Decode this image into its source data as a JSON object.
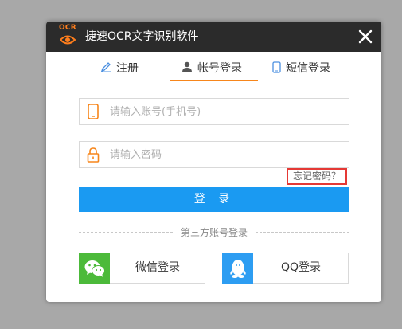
{
  "window": {
    "logo_text": "OCR",
    "title": "捷速OCR文字识别软件"
  },
  "tabs": [
    {
      "label": "注册",
      "icon": "pencil-icon",
      "active": false
    },
    {
      "label": "帐号登录",
      "icon": "user-icon",
      "active": true
    },
    {
      "label": "短信登录",
      "icon": "phone-icon",
      "active": false
    }
  ],
  "form": {
    "account_placeholder": "请输入账号(手机号)",
    "password_placeholder": "请输入密码",
    "forgot_label": "忘记密码？",
    "login_label": "登 录"
  },
  "third_party": {
    "divider_label": "第三方账号登录",
    "wechat_label": "微信登录",
    "qq_label": "QQ登录"
  },
  "colors": {
    "accent": "#f7861b",
    "primary": "#1a9af2",
    "wechat": "#4cba3a",
    "qq": "#2d9df2",
    "titlebar": "#2b2b2b"
  }
}
